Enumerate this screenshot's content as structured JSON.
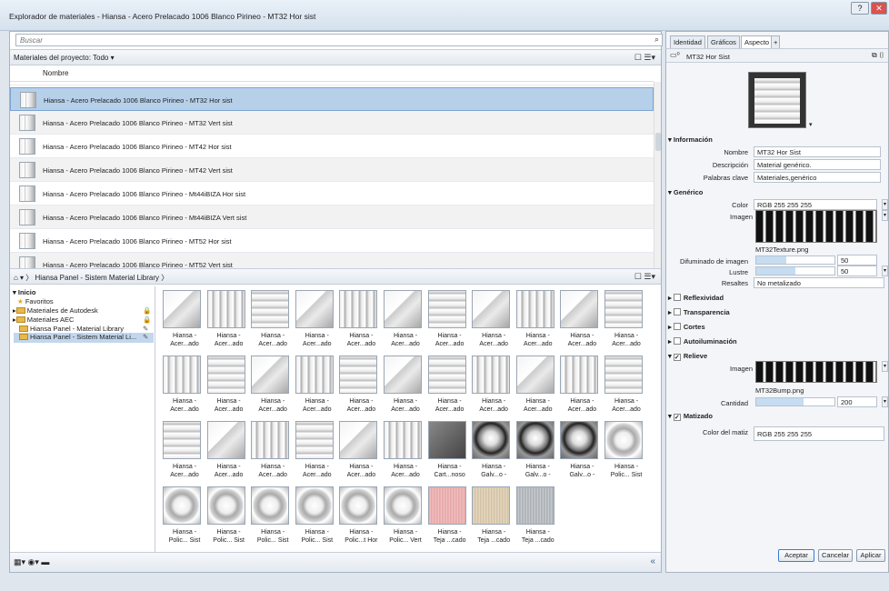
{
  "window": {
    "title": "Explorador de materiales - Hiansa - Acero Prelacado 1006 Blanco Pirineo - MT32 Hor sist",
    "help": "?",
    "close": "✕"
  },
  "search": {
    "placeholder": "Buscar"
  },
  "project": {
    "label": "Materiales del proyecto: Todo ▾",
    "column": "Nombre"
  },
  "materials": [
    "Hiansa - Acero Prelacado 1006 Blanco Pirineo - MT32 Hor sist",
    "Hiansa - Acero Prelacado 1006 Blanco Pirineo - MT32 Vert sist",
    "Hiansa - Acero Prelacado 1006 Blanco Pirineo - MT42 Hor sist",
    "Hiansa - Acero Prelacado 1006 Blanco Pirineo - MT42 Vert sist",
    "Hiansa - Acero Prelacado 1006 Blanco Pirineo - Mt44iBIZA Hor sist",
    "Hiansa - Acero Prelacado 1006 Blanco Pirineo - Mt44iBIZA Vert sist",
    "Hiansa - Acero Prelacado 1006 Blanco Pirineo - MT52 Hor sist",
    "Hiansa - Acero Prelacado 1006 Blanco Pirineo - MT52 Vert sist"
  ],
  "library": {
    "breadcrumb": "Hiansa Panel - Sistem Material Library"
  },
  "tree": {
    "root": "Inicio",
    "items": [
      "Favoritos",
      "Materiales de Autodesk",
      "Materiales AEC",
      "Hiansa Panel - Material Library",
      "Hiansa Panel - Sistem Material Li..."
    ]
  },
  "tiles": [
    [
      "Hiansa -",
      "Acer...ado",
      "cube"
    ],
    [
      "Hiansa -",
      "Acer...ado",
      "cube2"
    ],
    [
      "Hiansa -",
      "Acer...ado",
      "cube3"
    ],
    [
      "Hiansa -",
      "Acer...ado",
      "cube"
    ],
    [
      "Hiansa -",
      "Acer...ado",
      "cube2"
    ],
    [
      "Hiansa -",
      "Acer...ado",
      "cube"
    ],
    [
      "Hiansa -",
      "Acer...ado",
      "cube3"
    ],
    [
      "Hiansa -",
      "Acer...ado",
      "cube"
    ],
    [
      "Hiansa -",
      "Acer...ado",
      "cube2"
    ],
    [
      "Hiansa -",
      "Acer...ado",
      "cube"
    ],
    [
      "Hiansa -",
      "Acer...ado",
      "cube3"
    ],
    [
      "Hiansa -",
      "Acer...ado",
      "cube2"
    ],
    [
      "Hiansa -",
      "Acer...ado",
      "cube3"
    ],
    [
      "Hiansa -",
      "Acer...ado",
      "cube"
    ],
    [
      "Hiansa -",
      "Acer...ado",
      "cube2"
    ],
    [
      "Hiansa -",
      "Acer...ado",
      "cube3"
    ],
    [
      "Hiansa -",
      "Acer...ado",
      "cube"
    ],
    [
      "Hiansa -",
      "Acer...ado",
      "cube3"
    ],
    [
      "Hiansa -",
      "Acer...ado",
      "cube2"
    ],
    [
      "Hiansa -",
      "Acer...ado",
      "cube"
    ],
    [
      "Hiansa -",
      "Acer...ado",
      "cube2"
    ],
    [
      "Hiansa -",
      "Acer...ado",
      "cube3"
    ],
    [
      "Hiansa -",
      "Acer...ado",
      "cube3"
    ],
    [
      "Hiansa -",
      "Acer...ado",
      "cube"
    ],
    [
      "Hiansa -",
      "Acer...ado",
      "cube2"
    ],
    [
      "Hiansa -",
      "Acer...ado",
      "cube3"
    ],
    [
      "Hiansa -",
      "Acer...ado",
      "cube"
    ],
    [
      "Hiansa -",
      "Acer...ado",
      "cube2"
    ],
    [
      "Hiansa -",
      "Cart...noso",
      "dark"
    ],
    [
      "Hiansa -",
      "Galv...o -",
      "sphere"
    ],
    [
      "Hiansa -",
      "Galv...o -",
      "sphere"
    ],
    [
      "Hiansa -",
      "Galv...o -",
      "sphere"
    ],
    [
      "Hiansa -",
      "Polic... Sist",
      "poly"
    ],
    [
      "Hiansa -",
      "Polic... Sist",
      "poly"
    ],
    [
      "Hiansa -",
      "Polic... Sist",
      "poly"
    ],
    [
      "Hiansa -",
      "Polic... Sist",
      "poly"
    ],
    [
      "Hiansa -",
      "Polic... Sist",
      "poly"
    ],
    [
      "Hiansa -",
      "Polic...t Hor",
      "poly"
    ],
    [
      "Hiansa -",
      "Polic... Vert",
      "poly"
    ],
    [
      "Hiansa -",
      "Teja ...cado",
      "teja1"
    ],
    [
      "Hiansa -",
      "Teja ...cado",
      "teja2"
    ],
    [
      "Hiansa -",
      "Teja ...cado",
      "teja3"
    ]
  ],
  "tabs": [
    "Identidad",
    "Gráficos",
    "Aspecto",
    "+"
  ],
  "editor": {
    "asset_name": "MT32 Hor Sist",
    "info_header": "Información",
    "nombre_label": "Nombre",
    "nombre": "MT32 Hor Sist",
    "descripcion_label": "Descripción",
    "descripcion": "Material genérico.",
    "palabras_label": "Palabras clave",
    "palabras": "Materiales,genérico",
    "generico_header": "Genérico",
    "color_label": "Color",
    "color": "RGB 255 255 255",
    "imagen_label": "Imagen",
    "imagen_file": "MT32Texture.png",
    "difuminado_label": "Difuminado de imagen",
    "difuminado": "50",
    "lustre_label": "Lustre",
    "lustre": "50",
    "resaltes_label": "Resaltes",
    "resaltes": "No metalizado",
    "reflexividad": "Reflexividad",
    "transparencia": "Transparencia",
    "cortes": "Cortes",
    "autoiluminacion": "Autoiluminación",
    "relieve_header": "Relieve",
    "relieve_imagen_label": "Imagen",
    "relieve_file": "MT32Bump.png",
    "cantidad_label": "Cantidad",
    "cantidad": "200",
    "matizado_header": "Matizado",
    "matiz_label": "Color del matiz",
    "matiz": "RGB 255 255 255"
  },
  "buttons": {
    "aceptar": "Aceptar",
    "cancelar": "Cancelar",
    "aplicar": "Aplicar"
  }
}
